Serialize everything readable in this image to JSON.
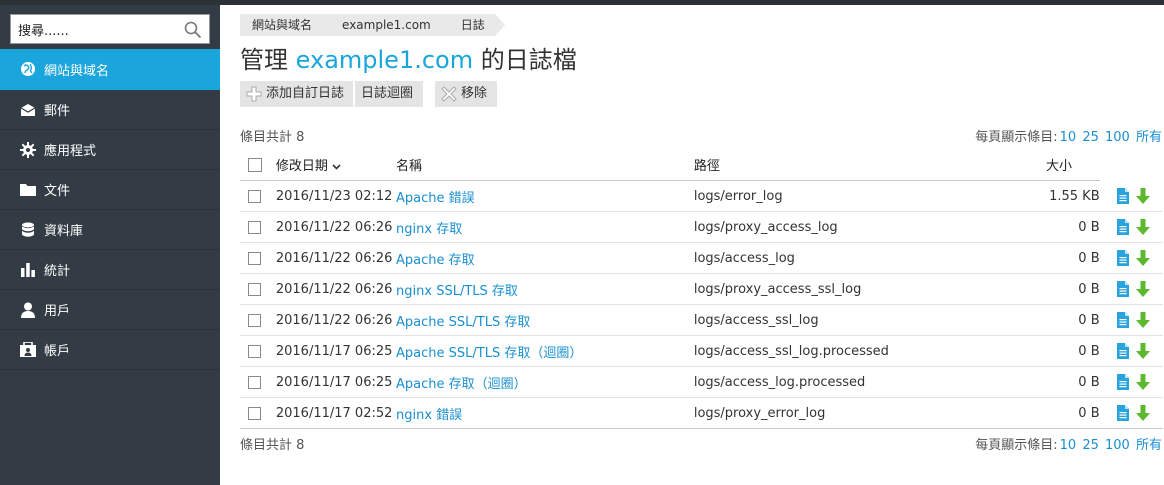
{
  "search": {
    "value": "搜尋......"
  },
  "sidebar": {
    "items": [
      {
        "label": "網站與域名",
        "icon": "globe-icon"
      },
      {
        "label": "郵件",
        "icon": "envelope-icon"
      },
      {
        "label": "應用程式",
        "icon": "gear-icon"
      },
      {
        "label": "文件",
        "icon": "folder-icon"
      },
      {
        "label": "資料庫",
        "icon": "database-icon"
      },
      {
        "label": "統計",
        "icon": "bar-chart-icon"
      },
      {
        "label": "用戶",
        "icon": "user-icon"
      },
      {
        "label": "帳戶",
        "icon": "account-icon"
      }
    ]
  },
  "breadcrumb": {
    "items": [
      "網站與域名",
      "example1.com",
      "日誌"
    ]
  },
  "title": {
    "prefix": "管理 ",
    "domain": "example1.com",
    "suffix": " 的日誌檔"
  },
  "toolbar": {
    "add_label": "添加自訂日誌",
    "rotate_label": "日誌迴圈",
    "remove_label": "移除"
  },
  "pagination": {
    "count_label": "條目共計 8",
    "per_page_label": "每頁顯示條目:",
    "options": [
      "10",
      "25",
      "100",
      "所有"
    ]
  },
  "table": {
    "headers": {
      "date": "修改日期",
      "name": "名稱",
      "path": "路徑",
      "size": "大小"
    },
    "rows": [
      {
        "date": "2016/11/23 02:12",
        "name": "Apache 錯誤",
        "path": "logs/error_log",
        "size": "1.55 KB"
      },
      {
        "date": "2016/11/22 06:26",
        "name": "nginx 存取",
        "path": "logs/proxy_access_log",
        "size": "0 B"
      },
      {
        "date": "2016/11/22 06:26",
        "name": "Apache 存取",
        "path": "logs/access_log",
        "size": "0 B"
      },
      {
        "date": "2016/11/22 06:26",
        "name": "nginx SSL/TLS 存取",
        "path": "logs/proxy_access_ssl_log",
        "size": "0 B"
      },
      {
        "date": "2016/11/22 06:26",
        "name": "Apache SSL/TLS 存取",
        "path": "logs/access_ssl_log",
        "size": "0 B"
      },
      {
        "date": "2016/11/17 06:25",
        "name": "Apache SSL/TLS 存取（迴圈）",
        "path": "logs/access_ssl_log.processed",
        "size": "0 B"
      },
      {
        "date": "2016/11/17 06:25",
        "name": "Apache 存取（迴圈）",
        "path": "logs/access_log.processed",
        "size": "0 B"
      },
      {
        "date": "2016/11/17 02:52",
        "name": "nginx 錯誤",
        "path": "logs/proxy_error_log",
        "size": "0 B"
      }
    ]
  },
  "colors": {
    "sidebar_bg": "#333c45",
    "active_item": "#1aa6dc",
    "link": "#1a8fd0",
    "download_icon": "#5cb82e"
  }
}
